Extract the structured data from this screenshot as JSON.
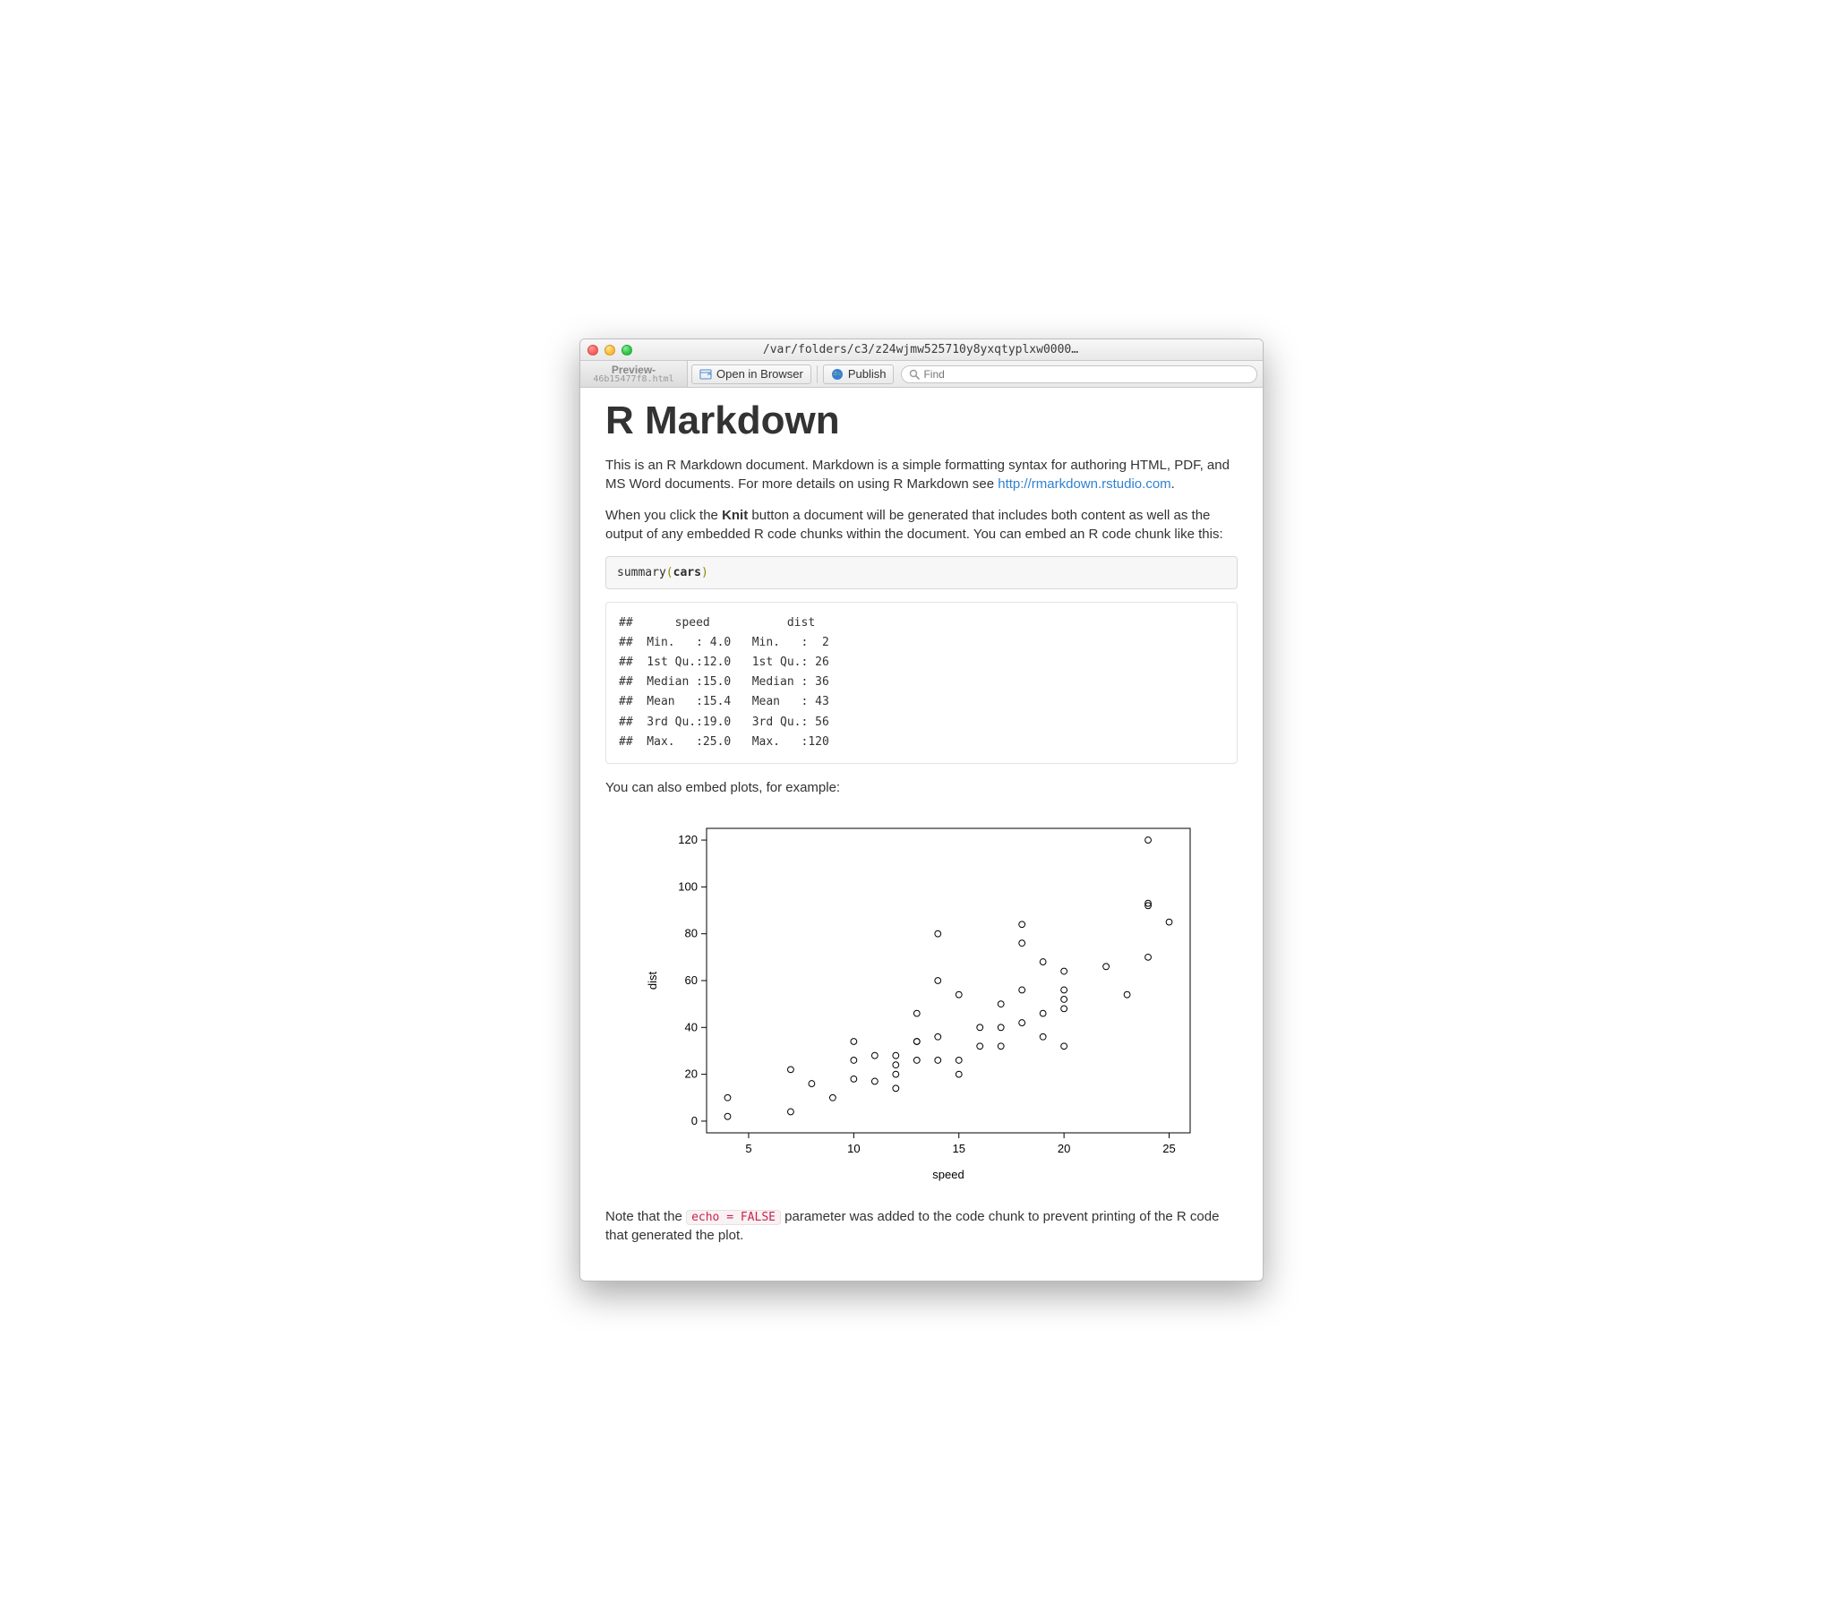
{
  "window": {
    "title": "/var/folders/c3/z24wjmw525710y8yxqtyplxw0000…"
  },
  "tab": {
    "line1": "Preview-",
    "line2": "46b15477f8.html"
  },
  "toolbar": {
    "open_label": "Open in Browser",
    "publish_label": "Publish",
    "search_placeholder": "Find"
  },
  "doc": {
    "h1": "R Markdown",
    "p1a": "This is an R Markdown document. Markdown is a simple formatting syntax for authoring HTML, PDF, and MS Word documents. For more details on using R Markdown see ",
    "p1_link": "http://rmarkdown.rstudio.com",
    "p1b": ".",
    "p2a": "When you click the ",
    "p2_bold": "Knit",
    "p2b": " button a document will be generated that includes both content as well as the output of any embedded R code chunks within the document. You can embed an R code chunk like this:",
    "code1": "summary(cars)",
    "output1": "##      speed           dist    \n##  Min.   : 4.0   Min.   :  2  \n##  1st Qu.:12.0   1st Qu.: 26  \n##  Median :15.0   Median : 36  \n##  Mean   :15.4   Mean   : 43  \n##  3rd Qu.:19.0   3rd Qu.: 56  \n##  Max.   :25.0   Max.   :120  ",
    "p3": "You can also embed plots, for example:",
    "p4a": "Note that the ",
    "p4_code": "echo = FALSE",
    "p4b": " parameter was added to the code chunk to prevent printing of the R code that generated the plot."
  },
  "chart_data": {
    "type": "scatter",
    "xlabel": "speed",
    "ylabel": "dist",
    "xlim": [
      3,
      26
    ],
    "ylim": [
      -5,
      125
    ],
    "xticks": [
      5,
      10,
      15,
      20,
      25
    ],
    "yticks": [
      0,
      20,
      40,
      60,
      80,
      100,
      120
    ],
    "points": [
      [
        4,
        2
      ],
      [
        4,
        10
      ],
      [
        7,
        4
      ],
      [
        7,
        22
      ],
      [
        8,
        16
      ],
      [
        9,
        10
      ],
      [
        10,
        18
      ],
      [
        10,
        26
      ],
      [
        10,
        34
      ],
      [
        11,
        17
      ],
      [
        11,
        28
      ],
      [
        12,
        14
      ],
      [
        12,
        20
      ],
      [
        12,
        24
      ],
      [
        12,
        28
      ],
      [
        13,
        26
      ],
      [
        13,
        34
      ],
      [
        13,
        34
      ],
      [
        13,
        46
      ],
      [
        14,
        26
      ],
      [
        14,
        36
      ],
      [
        14,
        60
      ],
      [
        14,
        80
      ],
      [
        15,
        20
      ],
      [
        15,
        26
      ],
      [
        15,
        54
      ],
      [
        16,
        32
      ],
      [
        16,
        40
      ],
      [
        17,
        32
      ],
      [
        17,
        40
      ],
      [
        17,
        50
      ],
      [
        18,
        42
      ],
      [
        18,
        56
      ],
      [
        18,
        76
      ],
      [
        18,
        84
      ],
      [
        19,
        36
      ],
      [
        19,
        46
      ],
      [
        19,
        68
      ],
      [
        20,
        32
      ],
      [
        20,
        48
      ],
      [
        20,
        52
      ],
      [
        20,
        56
      ],
      [
        20,
        64
      ],
      [
        22,
        66
      ],
      [
        23,
        54
      ],
      [
        24,
        70
      ],
      [
        24,
        92
      ],
      [
        24,
        93
      ],
      [
        24,
        120
      ],
      [
        25,
        85
      ]
    ]
  }
}
